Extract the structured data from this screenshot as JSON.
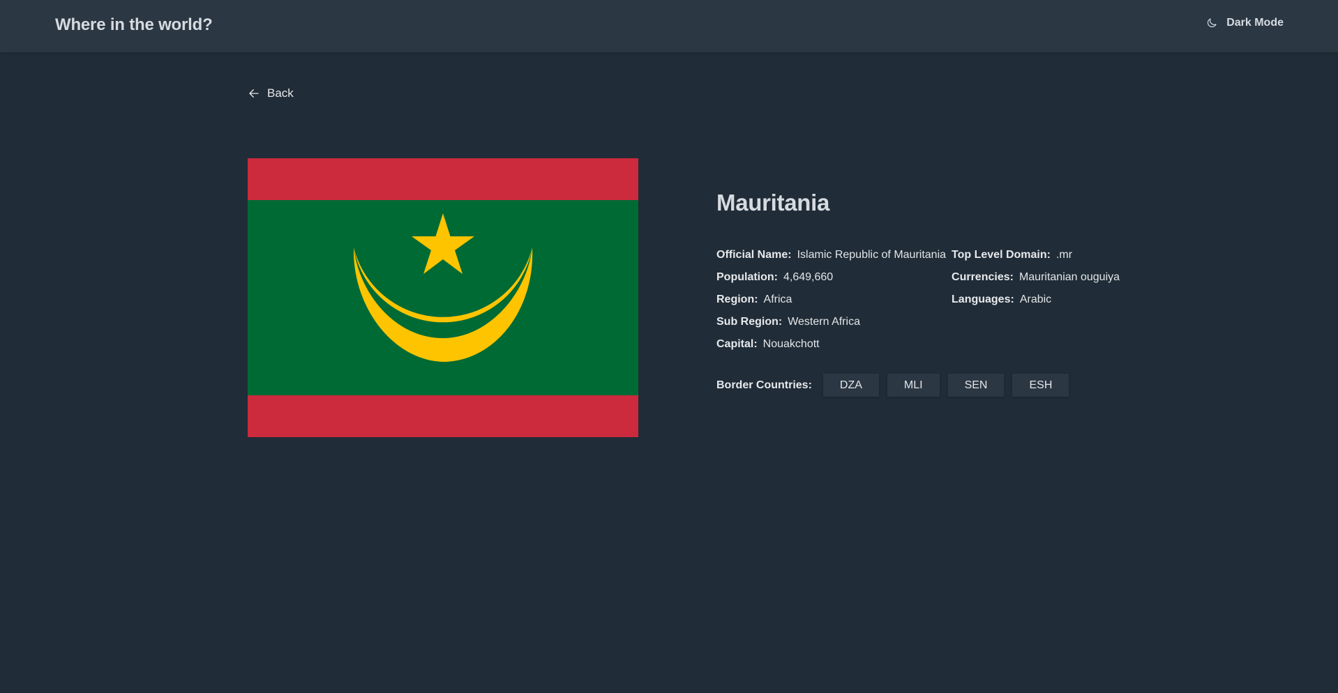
{
  "header": {
    "title": "Where in the world?",
    "mode_icon": "moon-icon",
    "mode_label": "Dark Mode"
  },
  "nav": {
    "back_icon": "arrow-left-icon",
    "back_label": "Back"
  },
  "country": {
    "name": "Mauritania",
    "flag_colors": {
      "red": "#cc2a3d",
      "green": "#006a35",
      "gold": "#ffc400"
    },
    "left_fields": [
      {
        "label": "Official Name:",
        "value": "Islamic Republic of Mauritania"
      },
      {
        "label": "Population:",
        "value": "4,649,660"
      },
      {
        "label": "Region:",
        "value": "Africa"
      },
      {
        "label": "Sub Region:",
        "value": "Western Africa"
      },
      {
        "label": "Capital:",
        "value": "Nouakchott"
      }
    ],
    "right_fields": [
      {
        "label": "Top Level Domain:",
        "value": ".mr"
      },
      {
        "label": "Currencies:",
        "value": "Mauritanian ouguiya"
      },
      {
        "label": "Languages:",
        "value": "Arabic"
      }
    ],
    "borders_label": "Border Countries:",
    "borders": [
      "DZA",
      "MLI",
      "SEN",
      "ESH"
    ]
  },
  "colors": {
    "background": "#202c37",
    "surface": "#2b3743",
    "text": "#ffffff"
  }
}
